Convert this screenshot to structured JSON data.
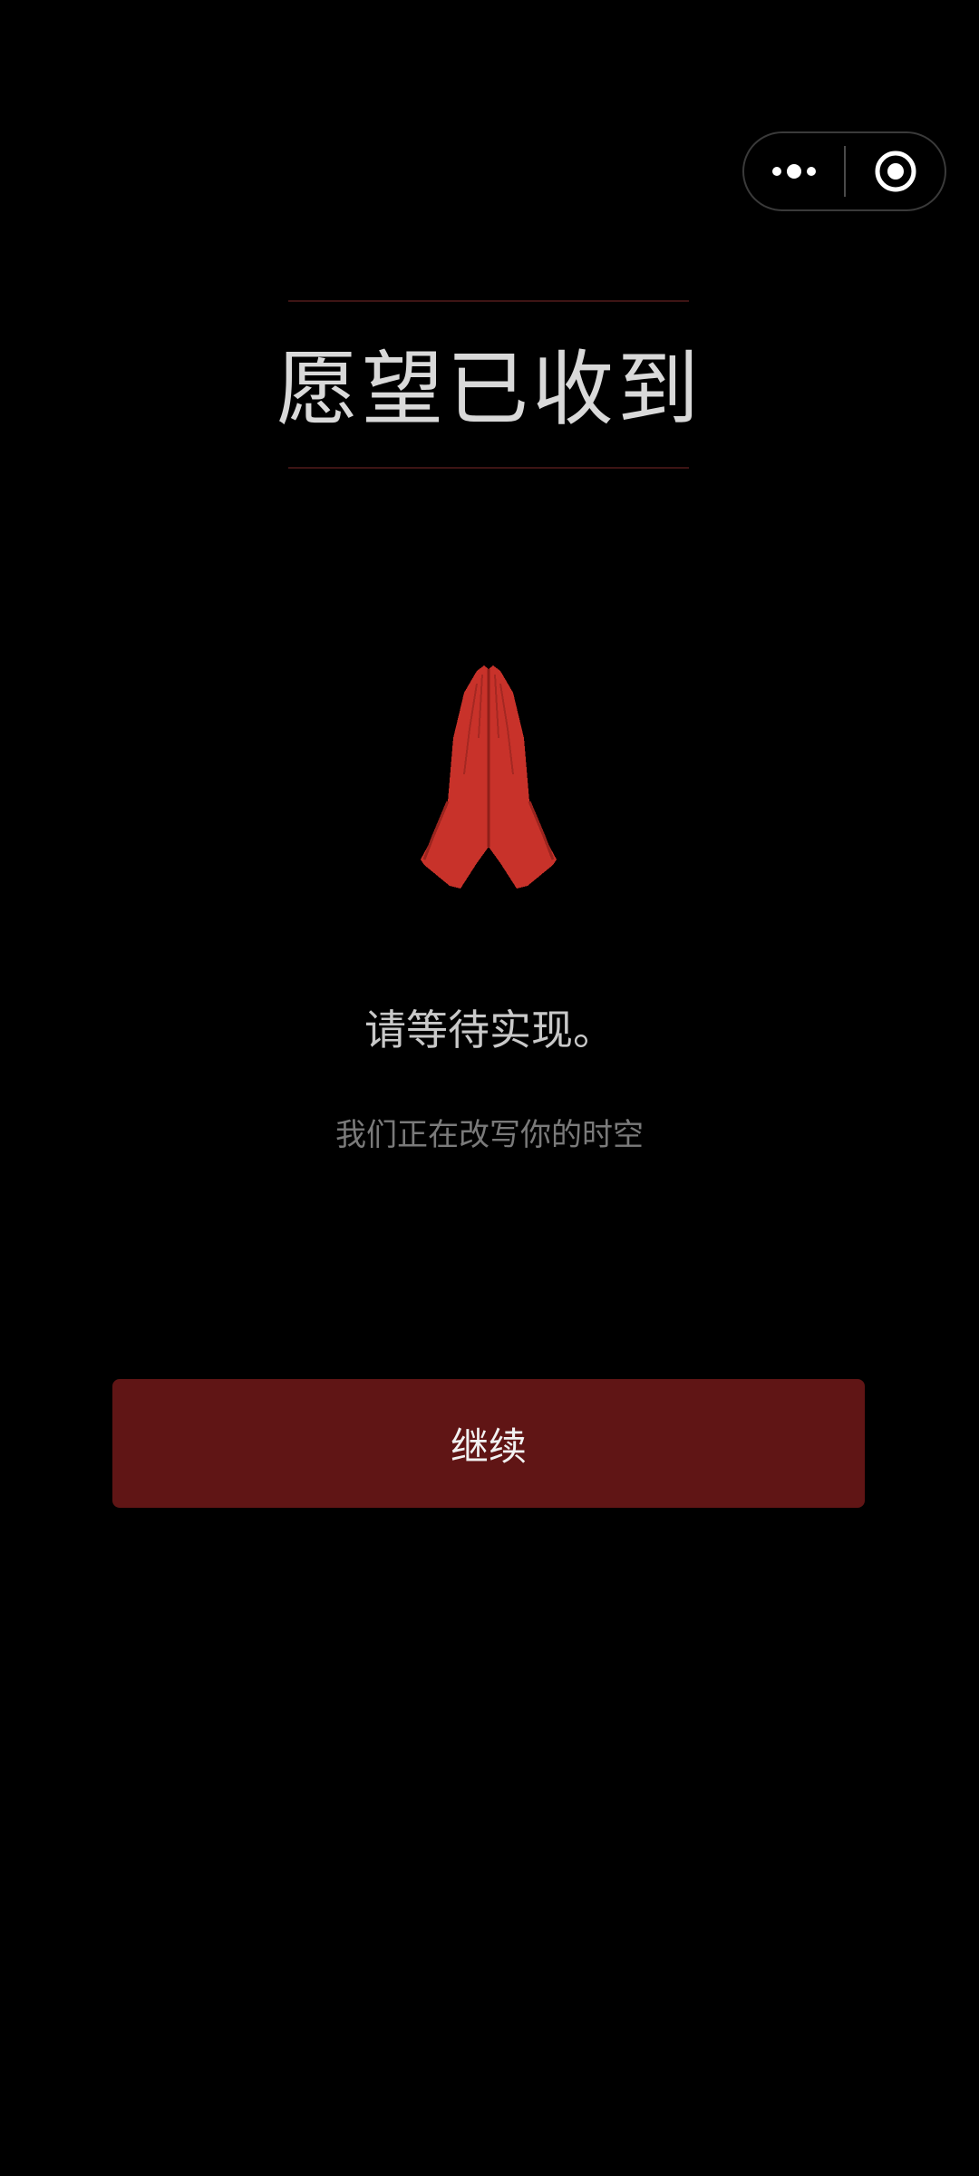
{
  "capsule": {
    "more_icon": "more-dots-icon",
    "close_icon": "target-circle-icon"
  },
  "main": {
    "title": "愿望已收到",
    "icon": "praying-hands-icon",
    "message": "请等待实现。",
    "submessage": "我们正在改写你的时空",
    "continue_label": "继续"
  },
  "colors": {
    "background": "#000000",
    "accent_red": "#c8322a",
    "button": "#601515",
    "title_rule": "#3d1414"
  }
}
